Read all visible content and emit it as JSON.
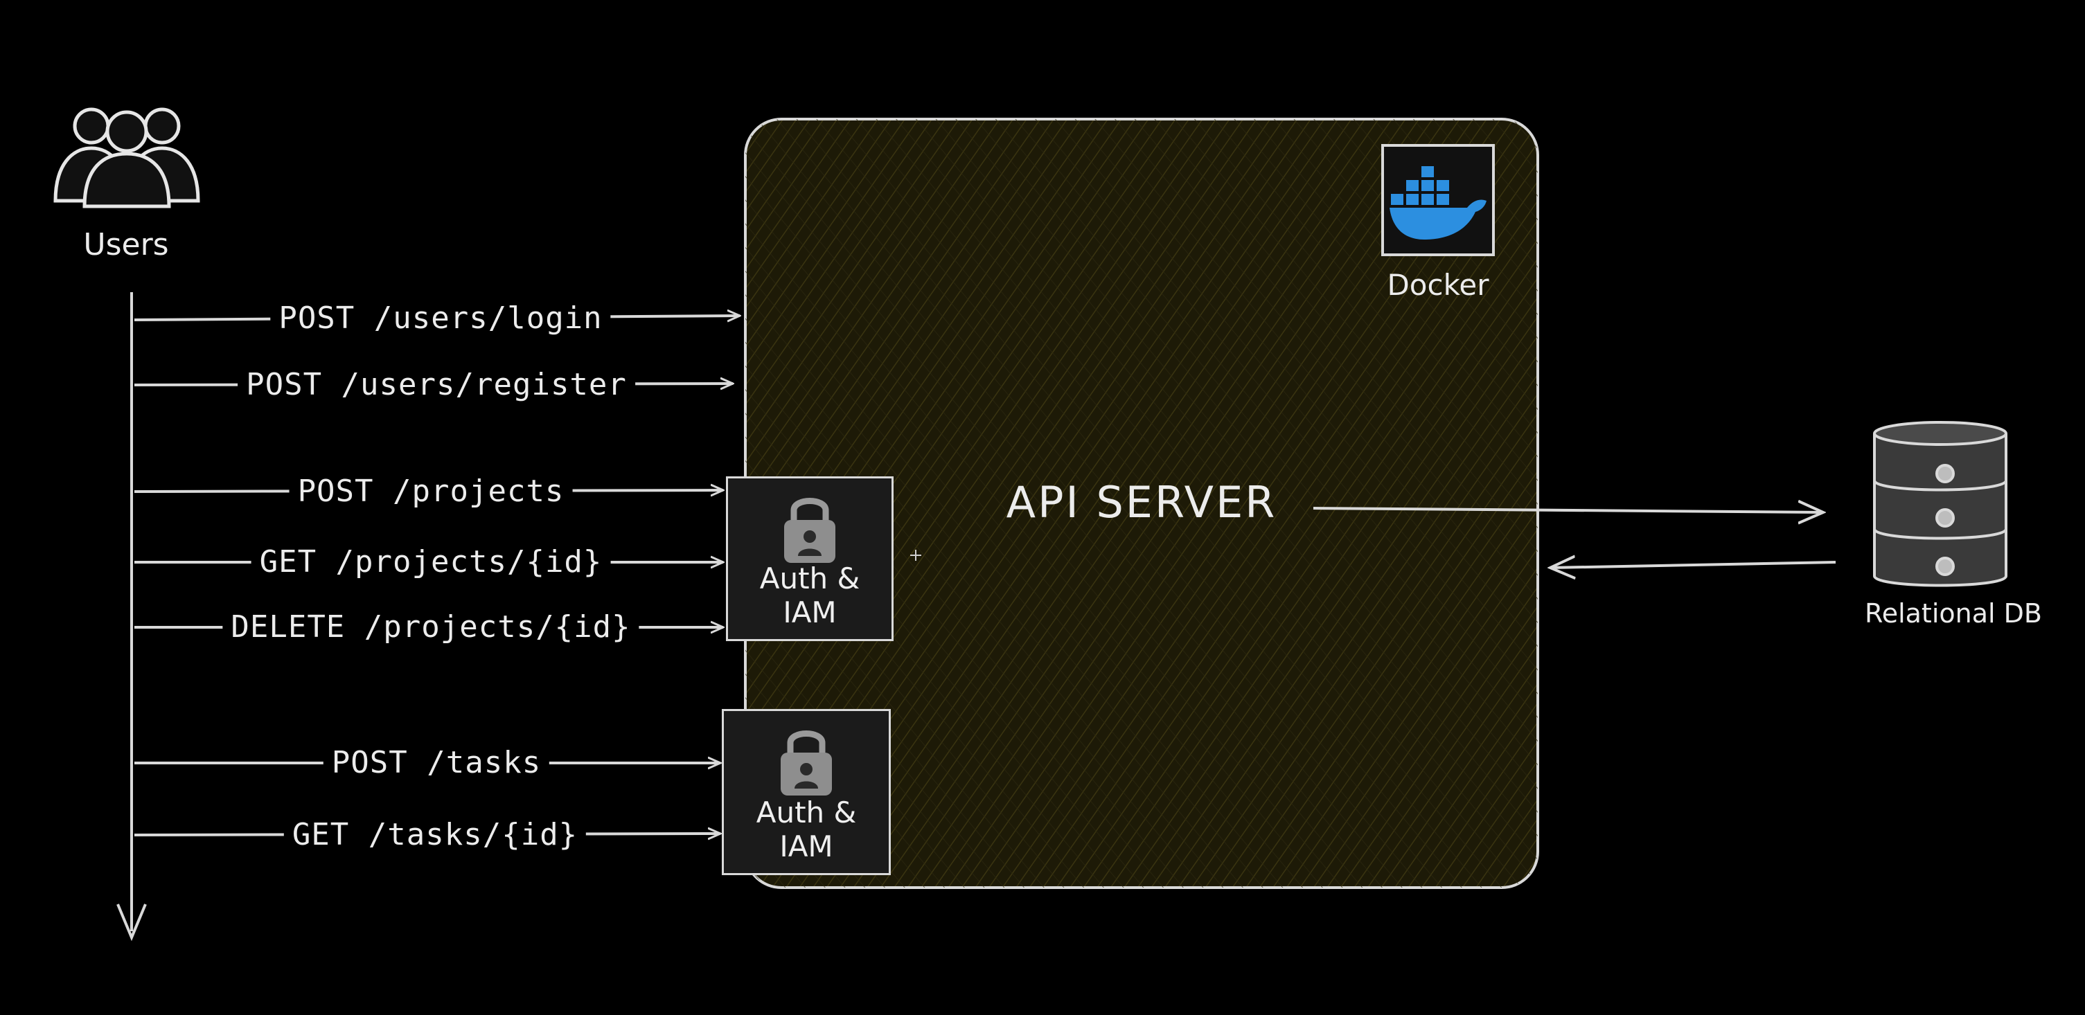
{
  "users": {
    "label": "Users"
  },
  "server": {
    "title": "API SERVER"
  },
  "docker": {
    "label": "Docker"
  },
  "database": {
    "label": "Relational DB"
  },
  "auth": {
    "label": "Auth &\nIAM"
  },
  "endpoints": [
    {
      "label": "POST /users/login"
    },
    {
      "label": "POST /users/register"
    },
    {
      "label": "POST /projects"
    },
    {
      "label": "GET /projects/{id}"
    },
    {
      "label": "DELETE /projects/{id}"
    },
    {
      "label": "POST /tasks"
    },
    {
      "label": "GET /tasks/{id}"
    }
  ],
  "colors": {
    "background": "#000000",
    "server_fill": "#1f1c08",
    "stroke": "#d9d9d9",
    "docker_blue": "#2c8fe0"
  }
}
